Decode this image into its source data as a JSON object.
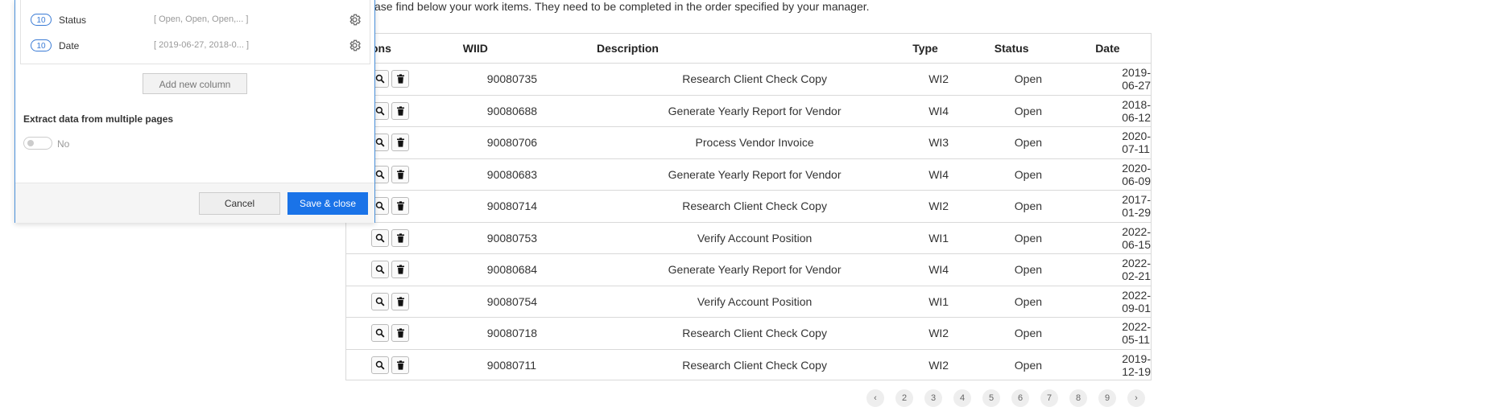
{
  "intro_text": "ase find below your work items. They need to be completed in the order specified by your manager.",
  "table": {
    "headers": [
      "ons",
      "WIID",
      "Description",
      "Type",
      "Status",
      "Date"
    ],
    "rows": [
      {
        "wiid": "90080735",
        "description": "Research Client Check Copy",
        "type": "WI2",
        "status": "Open",
        "date": "2019-06-27"
      },
      {
        "wiid": "90080688",
        "description": "Generate Yearly Report for Vendor",
        "type": "WI4",
        "status": "Open",
        "date": "2018-06-12"
      },
      {
        "wiid": "90080706",
        "description": "Process Vendor Invoice",
        "type": "WI3",
        "status": "Open",
        "date": "2020-07-11"
      },
      {
        "wiid": "90080683",
        "description": "Generate Yearly Report for Vendor",
        "type": "WI4",
        "status": "Open",
        "date": "2020-06-09"
      },
      {
        "wiid": "90080714",
        "description": "Research Client Check Copy",
        "type": "WI2",
        "status": "Open",
        "date": "2017-01-29"
      },
      {
        "wiid": "90080753",
        "description": "Verify Account Position",
        "type": "WI1",
        "status": "Open",
        "date": "2022-06-15"
      },
      {
        "wiid": "90080684",
        "description": "Generate Yearly Report for Vendor",
        "type": "WI4",
        "status": "Open",
        "date": "2022-02-21"
      },
      {
        "wiid": "90080754",
        "description": "Verify Account Position",
        "type": "WI1",
        "status": "Open",
        "date": "2022-09-01"
      },
      {
        "wiid": "90080718",
        "description": "Research Client Check Copy",
        "type": "WI2",
        "status": "Open",
        "date": "2022-05-11"
      },
      {
        "wiid": "90080711",
        "description": "Research Client Check Copy",
        "type": "WI2",
        "status": "Open",
        "date": "2019-12-19"
      }
    ],
    "row_action_icons": [
      "search-icon",
      "trash-icon"
    ]
  },
  "pagination": {
    "pages": [
      "‹",
      "2",
      "3",
      "4",
      "5",
      "6",
      "7",
      "8",
      "9",
      "›"
    ]
  },
  "dialog": {
    "columns": [
      {
        "count": "10",
        "name": "Status",
        "values": "[ Open, Open, Open,...  ]"
      },
      {
        "count": "10",
        "name": "Date",
        "values": "[ 2019-06-27, 2018-0...  ]"
      }
    ],
    "add_column_label": "Add new column",
    "extract_label": "Extract data from multiple pages",
    "toggle_label": "No",
    "cancel_label": "Cancel",
    "save_label": "Save & close"
  },
  "colors": {
    "accent": "#1a73e8",
    "border": "#d9d9d9",
    "panel_border": "#4a90d9"
  }
}
